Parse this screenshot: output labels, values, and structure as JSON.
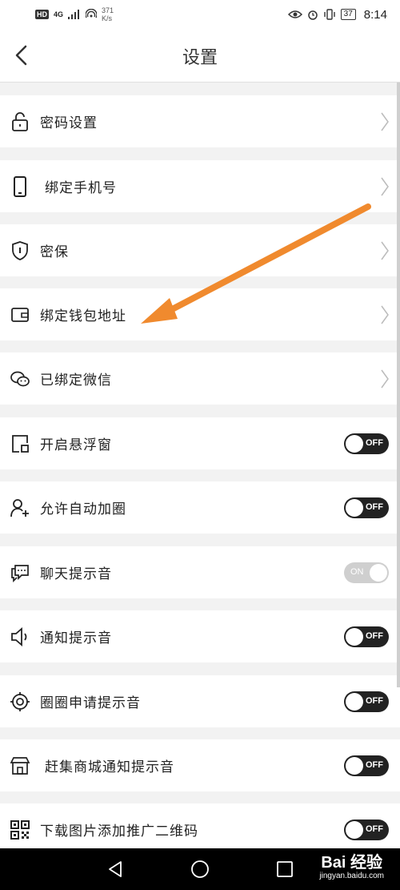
{
  "status_bar": {
    "hd": "HD",
    "network": "4G",
    "net_speed_value": "371",
    "net_speed_unit": "K/s",
    "battery": "37",
    "time": "8:14"
  },
  "header": {
    "title": "设置"
  },
  "rows": [
    {
      "label": "密码设置",
      "icon": "lock-icon",
      "control": "chevron"
    },
    {
      "label": "绑定手机号",
      "icon": "phone-icon",
      "control": "chevron"
    },
    {
      "label": "密保",
      "icon": "shield-icon",
      "control": "chevron"
    },
    {
      "label": "绑定钱包地址",
      "icon": "wallet-icon",
      "control": "chevron"
    },
    {
      "label": "已绑定微信",
      "icon": "wechat-icon",
      "control": "chevron"
    },
    {
      "label": "开启悬浮窗",
      "icon": "floating-window-icon",
      "control": "toggle",
      "toggle_state": "OFF"
    },
    {
      "label": "允许自动加圈",
      "icon": "add-user-icon",
      "control": "toggle",
      "toggle_state": "OFF"
    },
    {
      "label": "聊天提示音",
      "icon": "chat-icon",
      "control": "toggle",
      "toggle_state": "ON"
    },
    {
      "label": "通知提示音",
      "icon": "speaker-icon",
      "control": "toggle",
      "toggle_state": "OFF"
    },
    {
      "label": "圈圈申请提示音",
      "icon": "target-icon",
      "control": "toggle",
      "toggle_state": "OFF"
    },
    {
      "label": "赶集商城通知提示音",
      "icon": "store-icon",
      "control": "toggle",
      "toggle_state": "OFF"
    },
    {
      "label": "下载图片添加推广二维码",
      "icon": "qr-code-icon",
      "control": "toggle",
      "toggle_state": "OFF"
    }
  ],
  "watermark": {
    "logo": "Bai 经验",
    "sub": "jingyan.baidu.com"
  },
  "colors": {
    "arrow": "#f08a2e",
    "toggle_off": "#222222",
    "toggle_on": "#cfcfcf"
  }
}
